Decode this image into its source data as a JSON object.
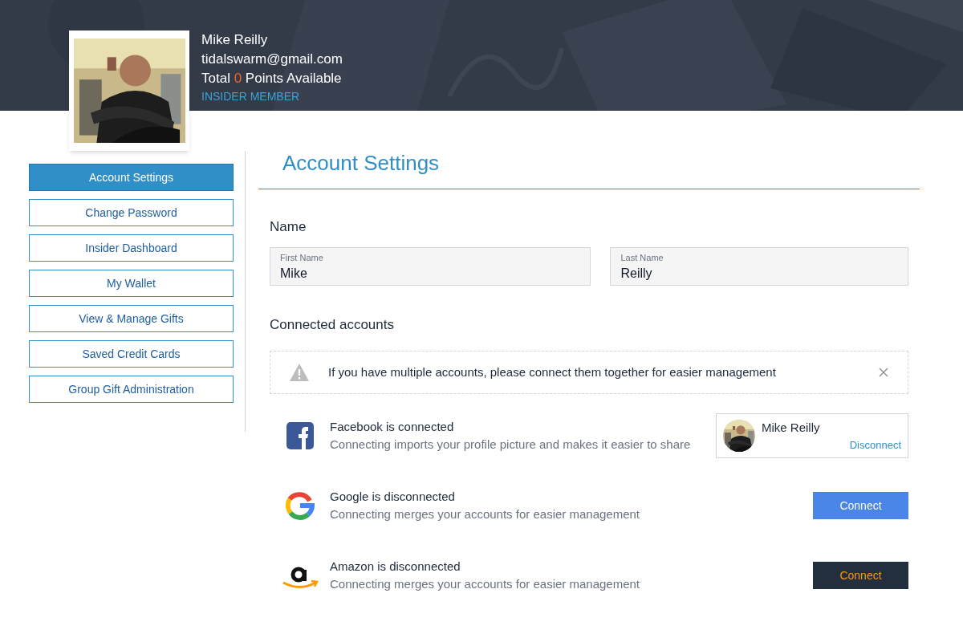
{
  "profile": {
    "name": "Mike Reilly",
    "email": "tidalswarm@gmail.com",
    "points": {
      "before": "Total",
      "value": "0",
      "after": "Points Available"
    },
    "tier": "INSIDER MEMBER"
  },
  "sidebar": {
    "items": [
      {
        "label": "Account Settings",
        "selected": true
      },
      {
        "label": "Change Password",
        "selected": false
      },
      {
        "label": "Insider Dashboard",
        "selected": false
      },
      {
        "label": "My Wallet",
        "selected": false
      },
      {
        "label": "View & Manage Gifts",
        "selected": false
      },
      {
        "label": "Saved Credit Cards",
        "selected": false
      },
      {
        "label": "Group Gift Administration",
        "selected": false
      }
    ]
  },
  "main": {
    "title": "Account Settings",
    "name_section": "Name",
    "fields": [
      {
        "label": "First Name",
        "value": "Mike"
      },
      {
        "label": "Last Name",
        "value": "Reilly"
      }
    ],
    "connected_section": "Connected accounts",
    "notice": "If you have multiple accounts, please connect them together for easier management",
    "accounts": [
      {
        "kind": "facebook",
        "connected": true,
        "status": "Facebook is connected",
        "description": "Connecting imports your profile picture and makes it easier to share",
        "profile_name": "Mike Reilly",
        "action": "Disconnect"
      },
      {
        "kind": "google",
        "connected": false,
        "status": "Google is disconnected",
        "description": "Connecting merges your accounts for easier management",
        "action": "Connect"
      },
      {
        "kind": "amazon",
        "connected": false,
        "status": "Amazon is disconnected",
        "description": "Connecting merges your accounts for easier management",
        "action": "Connect"
      }
    ]
  }
}
